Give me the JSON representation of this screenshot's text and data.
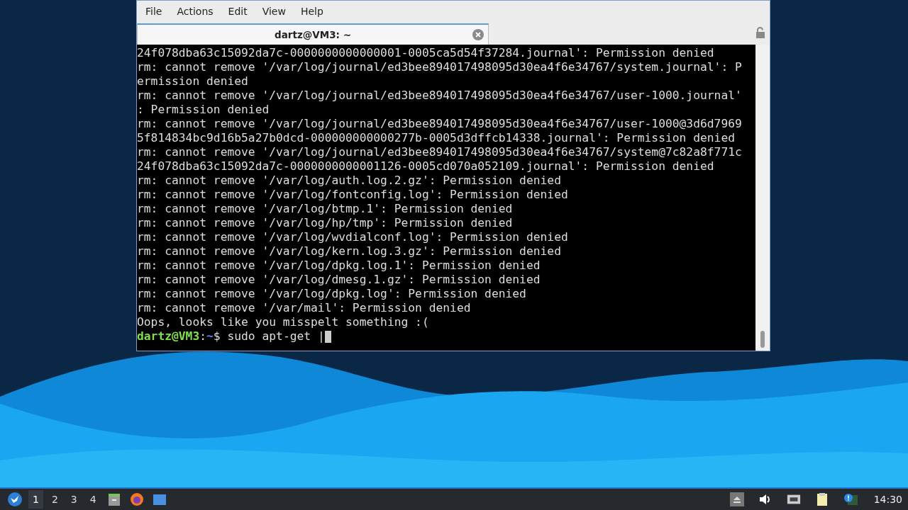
{
  "window": {
    "menu": [
      "File",
      "Actions",
      "Edit",
      "View",
      "Help"
    ],
    "tabs": [
      {
        "title": "dartz@VM3: ~",
        "selected": true
      }
    ],
    "terminal": {
      "lines": [
        "24f078dba63c15092da7c-0000000000000001-0005ca5d54f37284.journal': Permission denied",
        "rm: cannot remove '/var/log/journal/ed3bee894017498095d30ea4f6e34767/system.journal': P",
        "ermission denied",
        "rm: cannot remove '/var/log/journal/ed3bee894017498095d30ea4f6e34767/user-1000.journal'",
        ": Permission denied",
        "rm: cannot remove '/var/log/journal/ed3bee894017498095d30ea4f6e34767/user-1000@3d6d7969",
        "5f814834bc9d16b5a27b0dcd-000000000000277b-0005d3dffcb14338.journal': Permission denied",
        "rm: cannot remove '/var/log/journal/ed3bee894017498095d30ea4f6e34767/system@7c82a8f771c",
        "24f078dba63c15092da7c-0000000000001126-0005cd070a052109.journal': Permission denied",
        "rm: cannot remove '/var/log/auth.log.2.gz': Permission denied",
        "rm: cannot remove '/var/log/fontconfig.log': Permission denied",
        "rm: cannot remove '/var/log/btmp.1': Permission denied",
        "rm: cannot remove '/var/log/hp/tmp': Permission denied",
        "rm: cannot remove '/var/log/wvdialconf.log': Permission denied",
        "rm: cannot remove '/var/log/kern.log.3.gz': Permission denied",
        "rm: cannot remove '/var/log/dpkg.log.1': Permission denied",
        "rm: cannot remove '/var/log/dmesg.1.gz': Permission denied",
        "rm: cannot remove '/var/log/dpkg.log': Permission denied",
        "rm: cannot remove '/var/mail': Permission denied",
        "Oops, looks like you misspelt something :("
      ],
      "prompt": {
        "user": "dartz@VM3",
        "separator": ":",
        "path": "~",
        "command": "$ sudo apt-get |"
      }
    }
  },
  "taskbar": {
    "workspaces": [
      {
        "label": "1",
        "selected": true
      },
      {
        "label": "2",
        "selected": false
      },
      {
        "label": "3",
        "selected": false
      },
      {
        "label": "4",
        "selected": false
      }
    ],
    "clock": "14:30"
  }
}
